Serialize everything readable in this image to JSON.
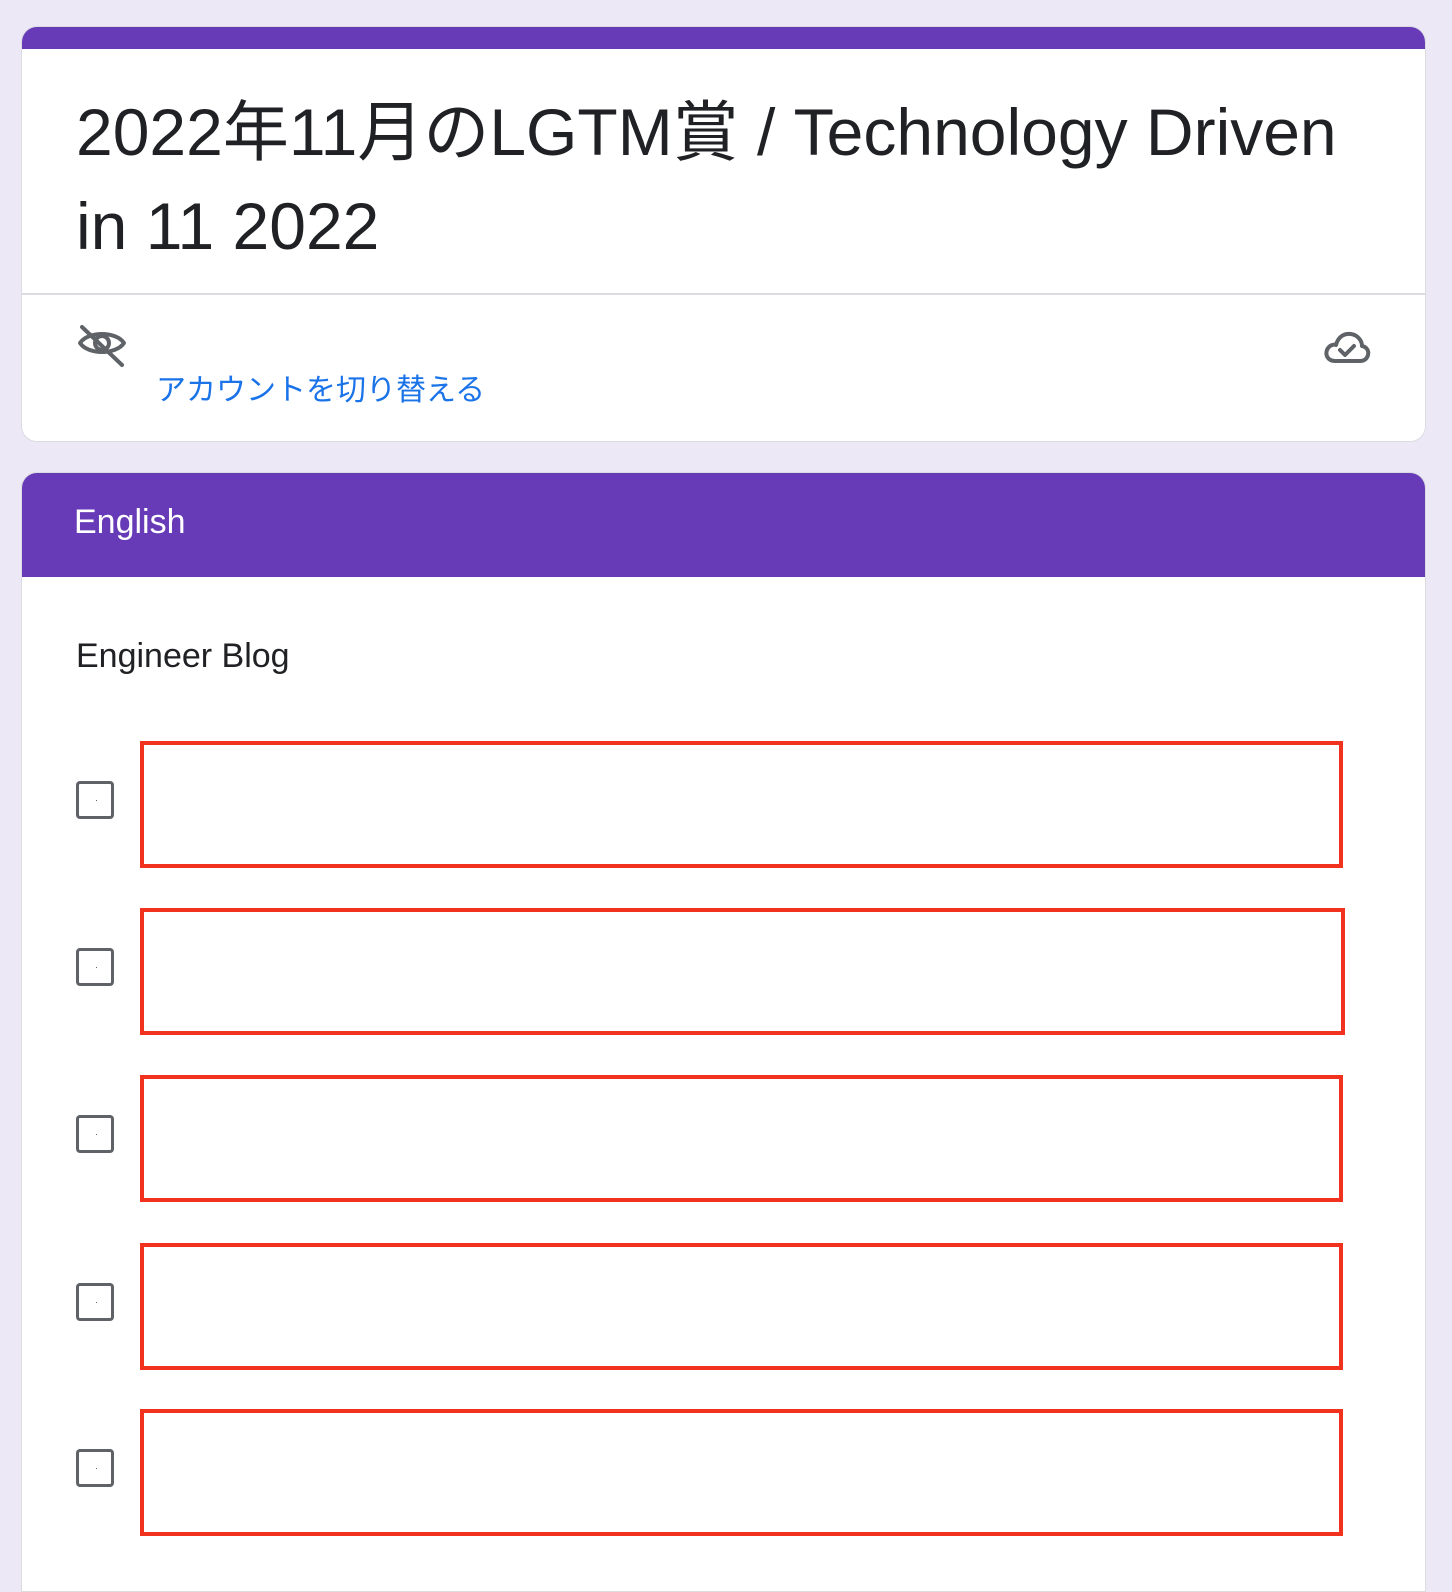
{
  "colors": {
    "accent": "#673ab7",
    "page_background": "#ede8f6",
    "link": "#1a73e8",
    "redaction_box": "#f0321e"
  },
  "form": {
    "title": "2022年11月のLGTM賞 / Technology Driven in 11 2022",
    "switch_account_label": "アカウントを切り替える",
    "icons": {
      "visibility_off": "eye-off-icon",
      "saved": "cloud-done-icon"
    }
  },
  "section": {
    "title": "English",
    "question": {
      "title": "Engineer Blog",
      "options": [
        {
          "label": "",
          "redacted": true,
          "checked": false
        },
        {
          "label": "",
          "redacted": true,
          "checked": false
        },
        {
          "label": "",
          "redacted": true,
          "checked": false
        },
        {
          "label": "",
          "redacted": true,
          "checked": false
        },
        {
          "label": "",
          "redacted": true,
          "checked": false
        }
      ]
    }
  }
}
